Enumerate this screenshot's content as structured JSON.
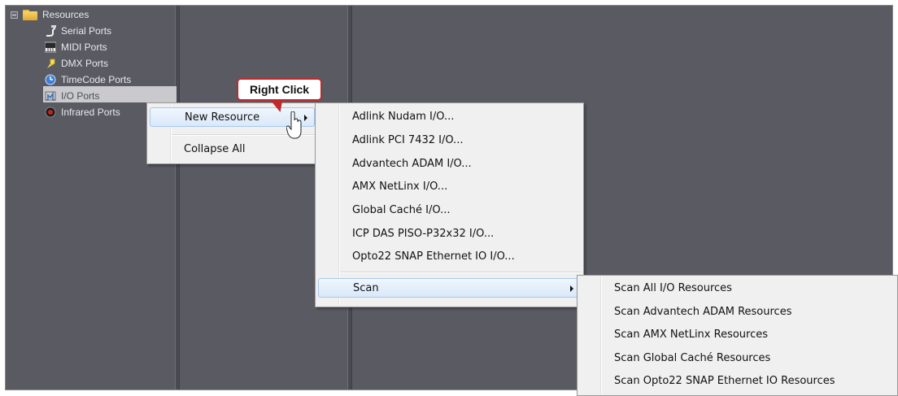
{
  "tree": {
    "root_label": "Resources",
    "items": [
      {
        "label": "Serial Ports",
        "icon": "serial-port-icon"
      },
      {
        "label": "MIDI Ports",
        "icon": "midi-keyboard-icon"
      },
      {
        "label": "DMX Ports",
        "icon": "dmx-icon"
      },
      {
        "label": "TimeCode Ports",
        "icon": "clock-icon"
      },
      {
        "label": "I/O Ports",
        "icon": "io-port-icon",
        "selected": true
      },
      {
        "label": "Infrared Ports",
        "icon": "infrared-icon"
      }
    ]
  },
  "callout": {
    "text": "Right Click"
  },
  "context_menu": {
    "items": [
      {
        "label": "New Resource",
        "has_submenu": true
      },
      {
        "label": "Collapse All"
      }
    ]
  },
  "resource_menu": {
    "items": [
      "Adlink Nudam I/O...",
      "Adlink PCI 7432 I/O...",
      "Advantech ADAM I/O...",
      "AMX NetLinx I/O...",
      "Global Caché I/O...",
      "ICP DAS PISO-P32x32 I/O...",
      "Opto22 SNAP Ethernet IO I/O..."
    ],
    "scan_label": "Scan"
  },
  "scan_menu": {
    "items": [
      "Scan All I/O Resources",
      "Scan Advantech ADAM Resources",
      "Scan AMX NetLinx Resources",
      "Scan Global Caché Resources",
      "Scan Opto22 SNAP Ethernet IO Resources"
    ]
  },
  "colors": {
    "panel_bg": "#5a5a62",
    "callout_border": "#c2272d",
    "menu_bg": "#f0f0f0",
    "menu_highlight": "#d9e8f9"
  }
}
